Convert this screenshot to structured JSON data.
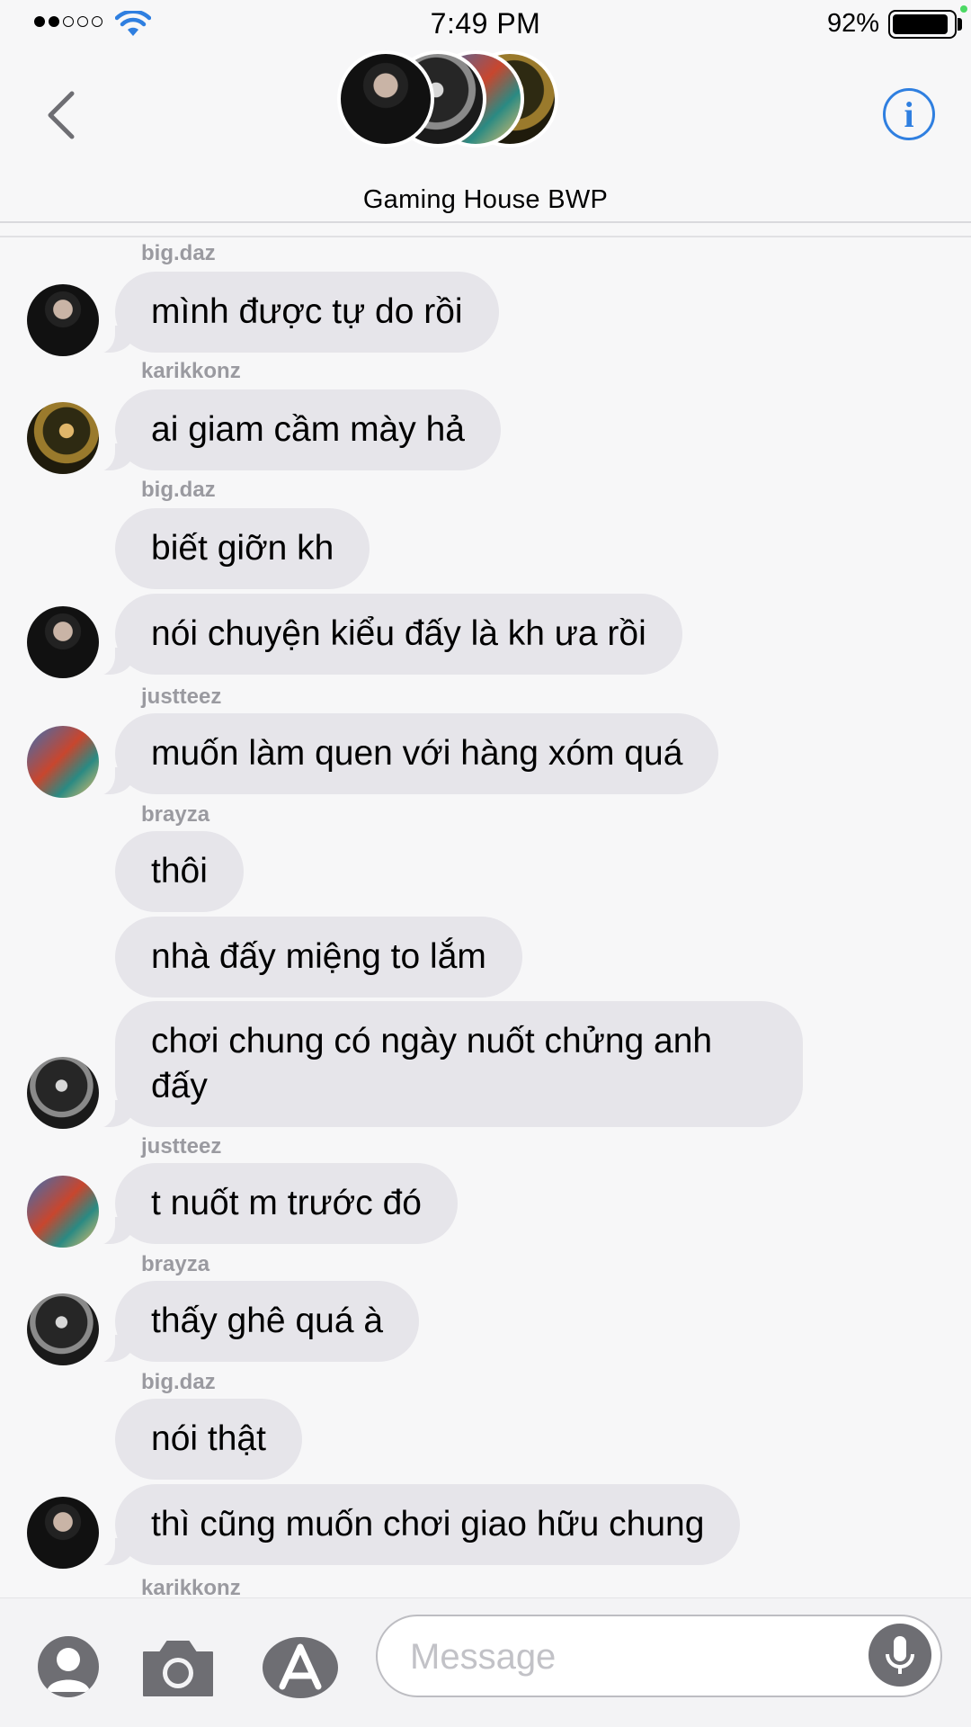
{
  "status": {
    "time": "7:49 PM",
    "battery": "92%",
    "battery_level": 0.92
  },
  "header": {
    "group_name": "Gaming House BWP",
    "back_icon": "chevron-left-icon",
    "info_icon": "info-icon",
    "info_glyph": "i"
  },
  "messages": [
    {
      "sender": "big.daz",
      "text": "mình được tự do rồi",
      "avatar": "daz"
    },
    {
      "sender": "karikkonz",
      "text": "ai giam cầm mày hả",
      "avatar": "karik"
    },
    {
      "sender": "big.daz",
      "text": "biết giỡn kh",
      "avatar": ""
    },
    {
      "sender": "",
      "text": "nói chuyện kiểu đấy là kh ưa rồi",
      "avatar": "daz"
    },
    {
      "sender": "justteez",
      "text": "muốn làm quen với hàng xóm quá",
      "avatar": "teez"
    },
    {
      "sender": "brayza",
      "text": "thôi",
      "avatar": ""
    },
    {
      "sender": "",
      "text": "nhà đấy miệng to lắm",
      "avatar": ""
    },
    {
      "sender": "",
      "text": "chơi chung có ngày nuốt chửng anh đấy",
      "avatar": "brayza"
    },
    {
      "sender": "justteez",
      "text": "t nuốt m trước đó",
      "avatar": "teez"
    },
    {
      "sender": "brayza",
      "text": "thấy ghê quá à",
      "avatar": "brayza"
    },
    {
      "sender": "big.daz",
      "text": "nói thật",
      "avatar": ""
    },
    {
      "sender": "",
      "text": "thì cũng muốn chơi giao hữu chung",
      "avatar": "daz"
    }
  ],
  "typing_sender": "karikkonz",
  "input": {
    "placeholder": "Message",
    "contact_icon": "contact-icon",
    "camera_icon": "camera-icon",
    "apps_icon": "app-store-icon",
    "mic_icon": "microphone-icon"
  },
  "colors": {
    "accent": "#2f7fe0",
    "bubble": "#e6e5ea",
    "background": "#f7f7f8",
    "sender_label": "#9a9aa0"
  }
}
